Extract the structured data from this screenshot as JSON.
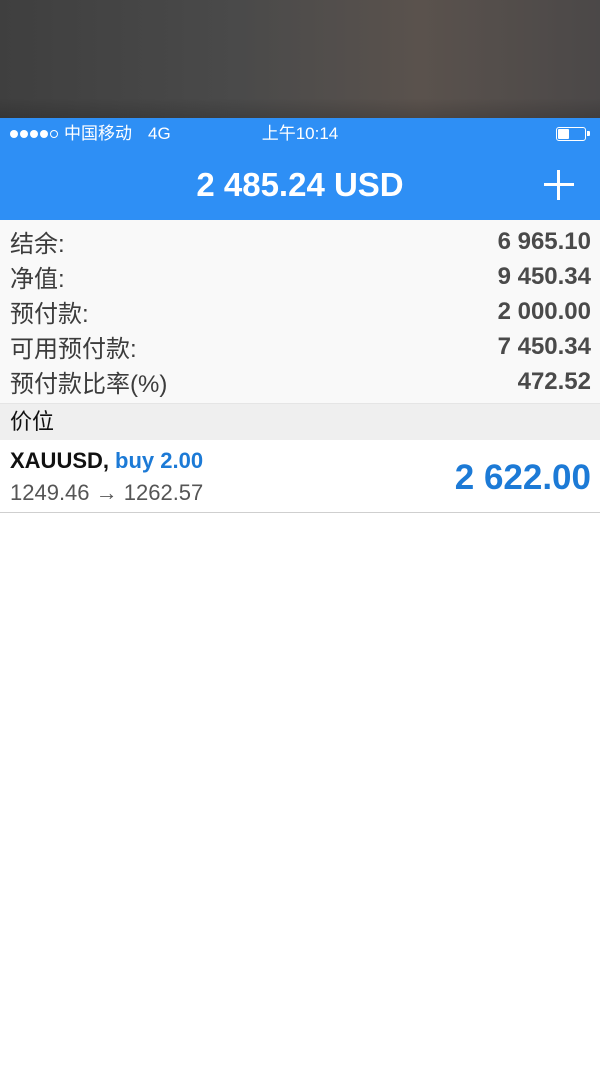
{
  "status_bar": {
    "carrier": "中国移动",
    "network": "4G",
    "time": "上午10:14",
    "battery_level": 0.4
  },
  "header": {
    "balance": "2 485.24 USD",
    "add_icon": "plus-icon"
  },
  "account": {
    "rows": [
      {
        "label": "结余:",
        "value": "6 965.10"
      },
      {
        "label": "净值:",
        "value": "9 450.34"
      },
      {
        "label": "预付款:",
        "value": "2 000.00"
      },
      {
        "label": "可用预付款:",
        "value": "7 450.34"
      },
      {
        "label": "预付款比率(%)",
        "value": "472.52"
      }
    ]
  },
  "positions": {
    "header": "价位",
    "items": [
      {
        "symbol": "XAUUSD,",
        "side": "buy 2.00",
        "prices": "1249.46 → 1262.57",
        "profit": "2 622.00"
      }
    ]
  },
  "colors": {
    "accent": "#2e8ff5",
    "profit": "#1c7ad6"
  }
}
